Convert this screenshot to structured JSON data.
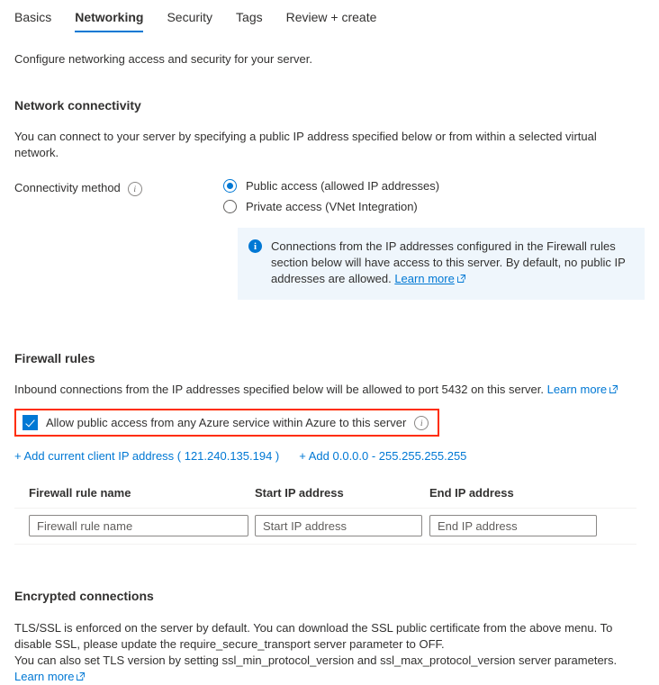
{
  "tabs": [
    {
      "label": "Basics",
      "active": false
    },
    {
      "label": "Networking",
      "active": true
    },
    {
      "label": "Security",
      "active": false
    },
    {
      "label": "Tags",
      "active": false
    },
    {
      "label": "Review + create",
      "active": false
    }
  ],
  "intro": "Configure networking access and security for your server.",
  "network_connectivity": {
    "title": "Network connectivity",
    "description": "You can connect to your server by specifying a public IP address specified below or from within a selected virtual network.",
    "connectivity_method_label": "Connectivity method",
    "info_icon": "info-icon",
    "options": [
      {
        "label": "Public access (allowed IP addresses)",
        "selected": true
      },
      {
        "label": "Private access (VNet Integration)",
        "selected": false
      }
    ],
    "banner": {
      "icon": "info-filled-icon",
      "text": "Connections from the IP addresses configured in the Firewall rules section below will have access to this server. By default, no public IP addresses are allowed.",
      "link_label": "Learn more",
      "background": "#eff6fc"
    }
  },
  "firewall_rules": {
    "title": "Firewall rules",
    "description": "Inbound connections from the IP addresses specified below will be allowed to port 5432 on this server.",
    "description_link": "Learn more",
    "allow_azure_checkbox": {
      "label": "Allow public access from any Azure service within Azure to this server",
      "checked": true,
      "highlight_color": "#ff2d00"
    },
    "add_client_ip_link": "+ Add current client IP address ( 121.240.135.194 )",
    "add_all_ip_link": "+ Add 0.0.0.0 - 255.255.255.255",
    "table": {
      "headers": [
        "Firewall rule name",
        "Start IP address",
        "End IP address"
      ],
      "rows": [
        {
          "rule_name_value": "",
          "rule_name_placeholder": "Firewall rule name",
          "start_ip_value": "",
          "start_ip_placeholder": "Start IP address",
          "end_ip_value": "",
          "end_ip_placeholder": "End IP address"
        }
      ]
    }
  },
  "encrypted_connections": {
    "title": "Encrypted connections",
    "line1": "TLS/SSL is enforced on the server by default. You can download the SSL public certificate from the above menu. To disable SSL, please update the require_secure_transport server parameter to OFF.",
    "line2": "You can also set TLS version by setting ssl_min_protocol_version and ssl_max_protocol_version server parameters.",
    "link_label": "Learn more"
  },
  "colors": {
    "accent": "#0078d4",
    "text": "#323130",
    "highlight": "#ff2d00",
    "banner_bg": "#eff6fc"
  }
}
